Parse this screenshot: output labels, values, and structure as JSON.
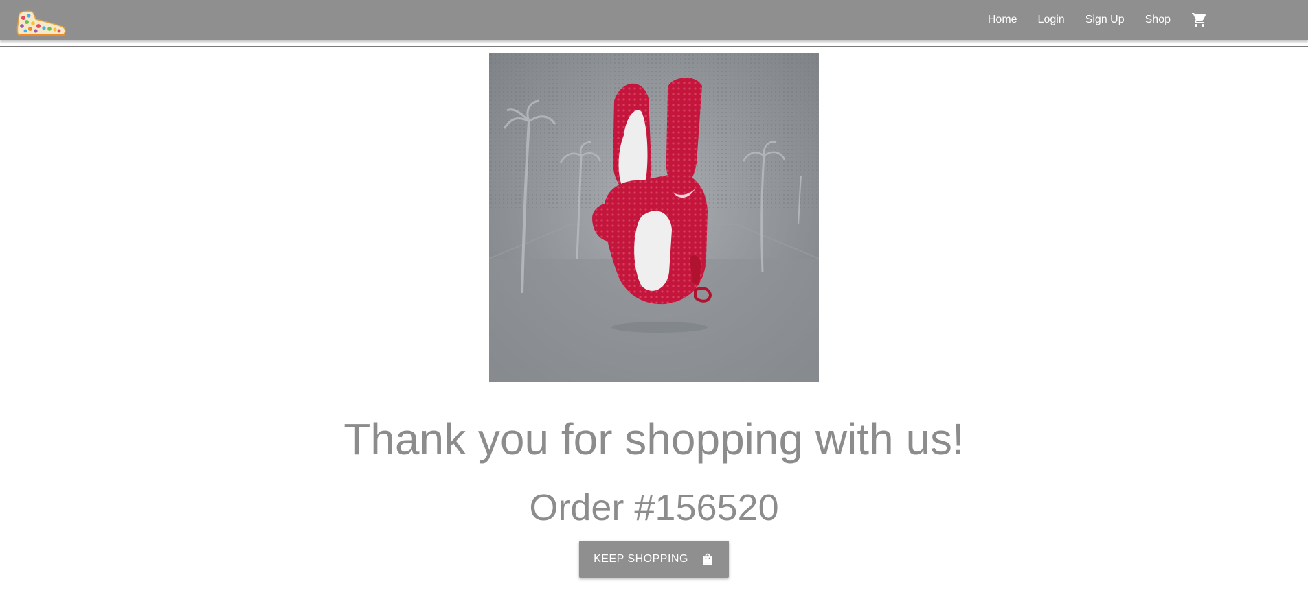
{
  "header": {
    "logo_icon": "sneaker-logo-icon",
    "nav": {
      "home": "Home",
      "login": "Login",
      "signup": "Sign Up",
      "shop": "Shop"
    },
    "cart_icon": "shopping-cart-icon"
  },
  "main": {
    "hero_image": "red-sneaker-peace-sign-image",
    "thanks_message": "Thank you for shopping with us!",
    "order_label": "Order #156520",
    "keep_shopping_label": "KEEP SHOPPING",
    "keep_shopping_icon": "shopping-bag-icon"
  },
  "colors": {
    "navbar": "#8f8f8f",
    "text_gray": "#8c8c8c",
    "button": "#8f8f8f",
    "shoe_red": "#c4163c"
  }
}
